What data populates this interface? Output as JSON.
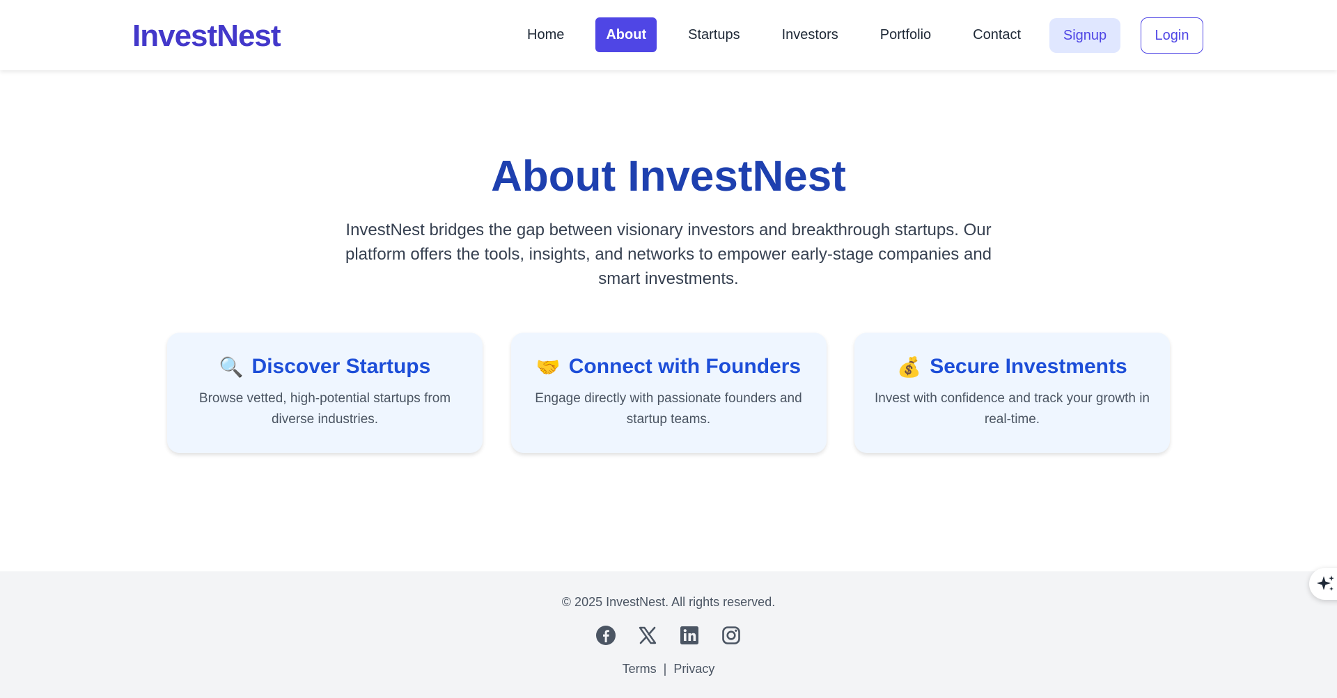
{
  "brand": {
    "name": "InvestNest",
    "color": "#4338ca"
  },
  "nav": {
    "items": [
      {
        "label": "Home",
        "active": false
      },
      {
        "label": "About",
        "active": true
      },
      {
        "label": "Startups",
        "active": false
      },
      {
        "label": "Investors",
        "active": false
      },
      {
        "label": "Portfolio",
        "active": false
      },
      {
        "label": "Contact",
        "active": false
      }
    ],
    "signup_label": "Signup",
    "login_label": "Login"
  },
  "hero": {
    "title": "About InvestNest",
    "description": "InvestNest bridges the gap between visionary investors and breakthrough startups. Our platform offers the tools, insights, and networks to empower early-stage companies and smart investments."
  },
  "features": [
    {
      "icon": "magnifying-glass-icon",
      "emoji": "🔍",
      "title": "Discover Startups",
      "description": "Browse vetted, high-potential startups from diverse industries."
    },
    {
      "icon": "handshake-icon",
      "emoji": "🤝",
      "title": "Connect with Founders",
      "description": "Engage directly with passionate founders and startup teams."
    },
    {
      "icon": "money-bag-icon",
      "emoji": "💰",
      "title": "Secure Investments",
      "description": "Invest with confidence and track your growth in real-time."
    }
  ],
  "footer": {
    "copyright": "© 2025 InvestNest. All rights reserved.",
    "socials": [
      "facebook-icon",
      "x-icon",
      "linkedin-icon",
      "instagram-icon"
    ],
    "terms_label": "Terms",
    "separator": "|",
    "privacy_label": "Privacy"
  },
  "colors": {
    "accent": "#4f46e5",
    "heading": "#1e40af",
    "card_bg": "#eff6ff",
    "footer_bg": "#f3f4f6"
  }
}
